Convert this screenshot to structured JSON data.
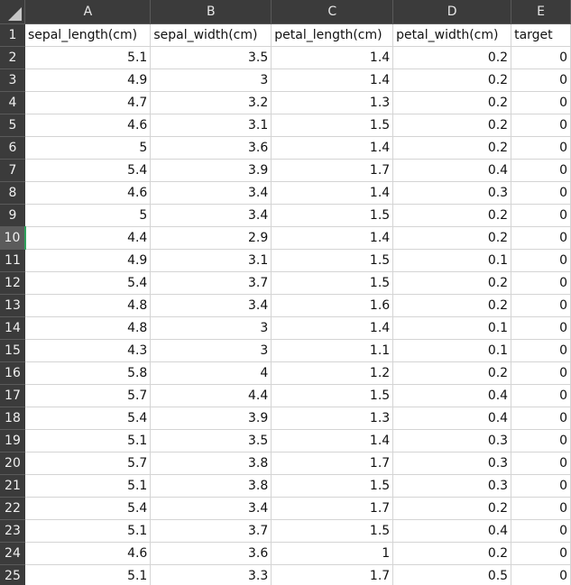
{
  "columns": [
    "A",
    "B",
    "C",
    "D",
    "E"
  ],
  "header_row": {
    "row_number": "1",
    "values": [
      "sepal_length(cm)",
      "sepal_width(cm)",
      "petal_length(cm)",
      "petal_width(cm)",
      "target"
    ]
  },
  "active_row": "10",
  "rows": [
    {
      "n": "2",
      "v": [
        "5.1",
        "3.5",
        "1.4",
        "0.2",
        "0"
      ]
    },
    {
      "n": "3",
      "v": [
        "4.9",
        "3",
        "1.4",
        "0.2",
        "0"
      ]
    },
    {
      "n": "4",
      "v": [
        "4.7",
        "3.2",
        "1.3",
        "0.2",
        "0"
      ]
    },
    {
      "n": "5",
      "v": [
        "4.6",
        "3.1",
        "1.5",
        "0.2",
        "0"
      ]
    },
    {
      "n": "6",
      "v": [
        "5",
        "3.6",
        "1.4",
        "0.2",
        "0"
      ]
    },
    {
      "n": "7",
      "v": [
        "5.4",
        "3.9",
        "1.7",
        "0.4",
        "0"
      ]
    },
    {
      "n": "8",
      "v": [
        "4.6",
        "3.4",
        "1.4",
        "0.3",
        "0"
      ]
    },
    {
      "n": "9",
      "v": [
        "5",
        "3.4",
        "1.5",
        "0.2",
        "0"
      ]
    },
    {
      "n": "10",
      "v": [
        "4.4",
        "2.9",
        "1.4",
        "0.2",
        "0"
      ]
    },
    {
      "n": "11",
      "v": [
        "4.9",
        "3.1",
        "1.5",
        "0.1",
        "0"
      ]
    },
    {
      "n": "12",
      "v": [
        "5.4",
        "3.7",
        "1.5",
        "0.2",
        "0"
      ]
    },
    {
      "n": "13",
      "v": [
        "4.8",
        "3.4",
        "1.6",
        "0.2",
        "0"
      ]
    },
    {
      "n": "14",
      "v": [
        "4.8",
        "3",
        "1.4",
        "0.1",
        "0"
      ]
    },
    {
      "n": "15",
      "v": [
        "4.3",
        "3",
        "1.1",
        "0.1",
        "0"
      ]
    },
    {
      "n": "16",
      "v": [
        "5.8",
        "4",
        "1.2",
        "0.2",
        "0"
      ]
    },
    {
      "n": "17",
      "v": [
        "5.7",
        "4.4",
        "1.5",
        "0.4",
        "0"
      ]
    },
    {
      "n": "18",
      "v": [
        "5.4",
        "3.9",
        "1.3",
        "0.4",
        "0"
      ]
    },
    {
      "n": "19",
      "v": [
        "5.1",
        "3.5",
        "1.4",
        "0.3",
        "0"
      ]
    },
    {
      "n": "20",
      "v": [
        "5.7",
        "3.8",
        "1.7",
        "0.3",
        "0"
      ]
    },
    {
      "n": "21",
      "v": [
        "5.1",
        "3.8",
        "1.5",
        "0.3",
        "0"
      ]
    },
    {
      "n": "22",
      "v": [
        "5.4",
        "3.4",
        "1.7",
        "0.2",
        "0"
      ]
    },
    {
      "n": "23",
      "v": [
        "5.1",
        "3.7",
        "1.5",
        "0.4",
        "0"
      ]
    },
    {
      "n": "24",
      "v": [
        "4.6",
        "3.6",
        "1",
        "0.2",
        "0"
      ]
    },
    {
      "n": "25",
      "v": [
        "5.1",
        "3.3",
        "1.7",
        "0.5",
        "0"
      ]
    }
  ]
}
